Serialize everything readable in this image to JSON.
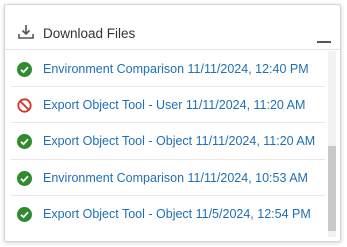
{
  "header": {
    "title": "Download Files",
    "icon": "download-icon",
    "minimize_icon": "minimize-icon"
  },
  "colors": {
    "link": "#1f6fb7",
    "success": "#2e8b2e",
    "error": "#d9302c"
  },
  "items": [
    {
      "status": "success",
      "icon": "check-circle-icon",
      "label": "Environment Comparison 11/11/2024, 12:40 PM"
    },
    {
      "status": "error",
      "icon": "prohibited-icon",
      "label": "Export Object Tool - User 11/11/2024, 11:20 AM"
    },
    {
      "status": "success",
      "icon": "check-circle-icon",
      "label": "Export Object Tool - Object 11/11/2024, 11:20 AM"
    },
    {
      "status": "success",
      "icon": "check-circle-icon",
      "label": "Environment Comparison 11/11/2024, 10:53 AM"
    },
    {
      "status": "success",
      "icon": "check-circle-icon",
      "label": "Export Object Tool - Object 11/5/2024, 12:54 PM"
    }
  ]
}
